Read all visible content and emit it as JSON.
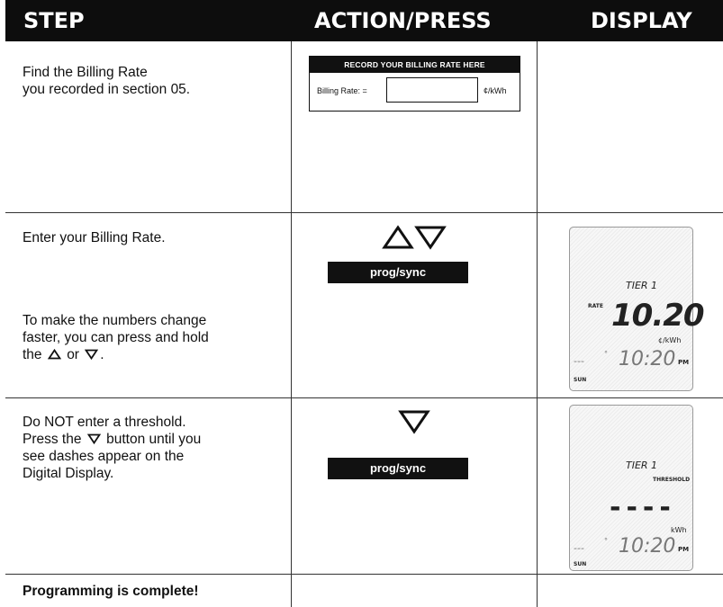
{
  "header": {
    "step": "STEP",
    "action": "ACTION/PRESS",
    "display": "DISPLAY"
  },
  "rows": [
    {
      "step_text": [
        "Find the Billing Rate",
        "you recorded in section 05."
      ],
      "record_box": {
        "title": "RECORD YOUR BILLING RATE HERE",
        "label": "Billing Rate: =",
        "unit": "¢/kWh"
      }
    },
    {
      "step_text": [
        "Enter your Billing Rate."
      ],
      "hint_text": [
        "To make the numbers change",
        "faster, you can press and hold",
        "the",
        "or"
      ],
      "button_label": "prog/sync",
      "display": {
        "tier": "TIER 1",
        "rate_label": "RATE",
        "value": "10.20",
        "unit": "¢/kWh",
        "dashes": "---",
        "time": "10:20",
        "ampm": "PM",
        "day": "SUN"
      }
    },
    {
      "step_text": [
        "Do NOT enter a threshold.",
        "Press the",
        "button until you",
        "see dashes appear on the",
        "Digital Display."
      ],
      "button_label": "prog/sync",
      "display": {
        "tier": "TIER 1",
        "threshold_label": "THRESHOLD",
        "value_dashes": "----",
        "unit": "kWh",
        "dashes": "---",
        "time": "10:20",
        "ampm": "PM",
        "day": "SUN"
      }
    },
    {
      "step_text": [
        "Programming is complete!"
      ]
    }
  ],
  "colors": {
    "header_bg": "#0d0d0d",
    "header_text": "#ffffff",
    "button_bg": "#111111"
  },
  "icons": [
    "up-triangle-icon",
    "down-triangle-icon"
  ]
}
